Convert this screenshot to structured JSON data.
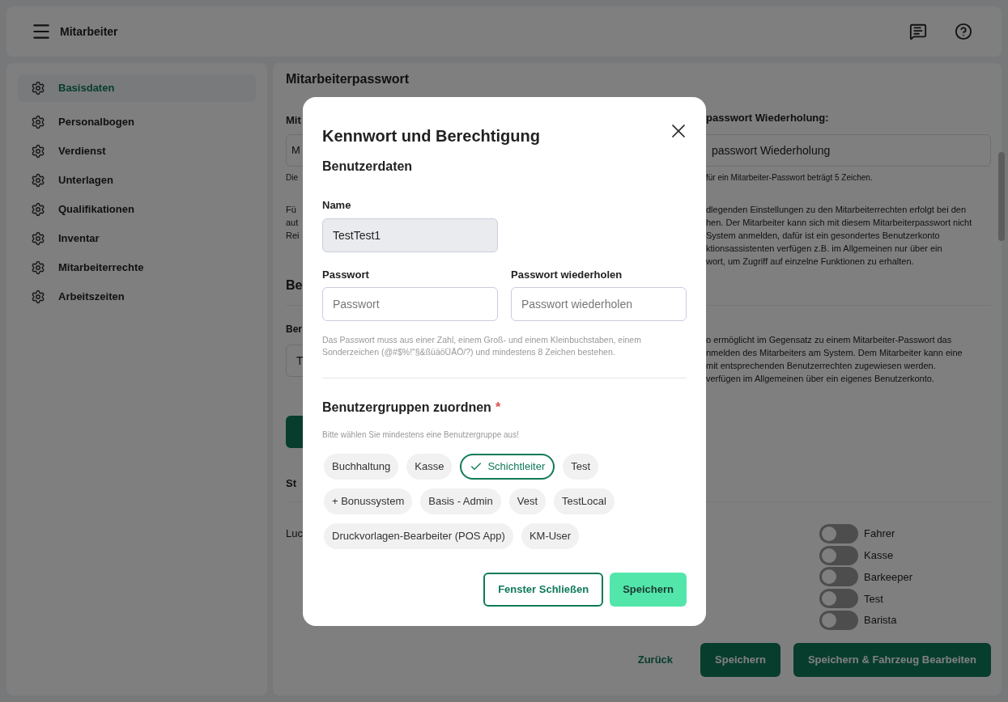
{
  "header": {
    "title": "Mitarbeiter"
  },
  "sidebar": {
    "items": [
      {
        "label": "Basisdaten",
        "selected": true
      },
      {
        "label": "Personalbogen",
        "selected": false
      },
      {
        "label": "Verdienst",
        "selected": false
      },
      {
        "label": "Unterlagen",
        "selected": false
      },
      {
        "label": "Qualifikationen",
        "selected": false
      },
      {
        "label": "Inventar",
        "selected": false
      },
      {
        "label": "Mitarbeiterrechte",
        "selected": false
      },
      {
        "label": "Arbeitszeiten",
        "selected": false
      }
    ]
  },
  "main": {
    "title": "Mitarbeiterpasswort",
    "label_left": "Mit",
    "label_right": "passwort Wiederholung:",
    "input_left": "M",
    "input_right_placeholder": "passwort Wiederholung",
    "hint_left": "Die",
    "hint_right": "für ein Mitarbeiter-Passwort beträgt 5 Zeichen.",
    "paragraph_left": [
      "Fü",
      "aut",
      "Rei"
    ],
    "paragraph_right": [
      "dlegenden Einstellungen zu den Mitarbeiterrechten erfolgt bei den",
      "hen. Der Mitarbeiter kann sich mit diesem Mitarbeiterpasswort nicht",
      "System anmelden, dafür ist ein gesondertes Benutzerkonto",
      "ktionsassistenten verfügen z.B. im Allgemeinen nur über ein",
      "wort, um Zugriff auf einzelne Funktionen zu erhalten."
    ],
    "section2_title": "Be",
    "section2_label": "Ber",
    "section2_input": "T",
    "section2_paragraph_right": [
      "o ermöglicht im Gegensatz zu einem Mitarbeiter-Passwort das",
      "nmelden des Mitarbeiters am System. Dem Mitarbeiter kann eine",
      "mit entsprechenden Benutzerrechten zugewiesen werden.",
      "verfügen im Allgemeinen über ein eigenes Benutzerkonto."
    ],
    "section3_title": "St",
    "section3_label": "Luc",
    "toggles": [
      {
        "label": "Fahrer",
        "on": false
      },
      {
        "label": "Kasse",
        "on": false
      },
      {
        "label": "Barkeeper",
        "on": false
      },
      {
        "label": "Test",
        "on": false
      },
      {
        "label": "Barista",
        "on": false
      }
    ],
    "footer_buttons": [
      {
        "label": "Zurück",
        "kind": "text"
      },
      {
        "label": "Speichern",
        "kind": "primary"
      },
      {
        "label": "Speichern & Fahrzeug Bearbeiten",
        "kind": "primary"
      }
    ]
  },
  "dialog": {
    "title": "Kennwort und Berechtigung",
    "subtitle": "Benutzerdaten",
    "name_label": "Name",
    "name_value": "TestTest1",
    "password_label": "Passwort",
    "password_placeholder": "Passwort",
    "repeat_label": "Passwort wiederholen",
    "repeat_placeholder": "Passwort wiederholen",
    "password_hint": "Das Passwort muss aus einer Zahl, einem Groß- und einem Kleinbuchstaben, einem Sonderzeichen (@#$%!\"§&ßüäöÜÄÖ/?) und mindestens 8 Zeichen bestehen.",
    "groups_title": "Benutzergruppen zuordnen",
    "required_mark": "*",
    "groups_hint": "Bitte wählen Sie mindestens eine Benutzergruppe aus!",
    "groups": [
      {
        "label": "Buchhaltung",
        "selected": false
      },
      {
        "label": "Kasse",
        "selected": false
      },
      {
        "label": "Schichtleiter",
        "selected": true
      },
      {
        "label": "Test",
        "selected": false
      },
      {
        "label": "+ Bonussystem",
        "selected": false
      },
      {
        "label": "Basis - Admin",
        "selected": false
      },
      {
        "label": "Vest",
        "selected": false
      },
      {
        "label": "TestLocal",
        "selected": false
      },
      {
        "label": "Druckvorlagen-Bearbeiter (POS App)",
        "selected": false
      },
      {
        "label": "KM-User",
        "selected": false
      }
    ],
    "buttons": [
      {
        "label": "Fenster Schließen",
        "kind": "outline"
      },
      {
        "label": "Speichern",
        "kind": "primary"
      }
    ]
  }
}
